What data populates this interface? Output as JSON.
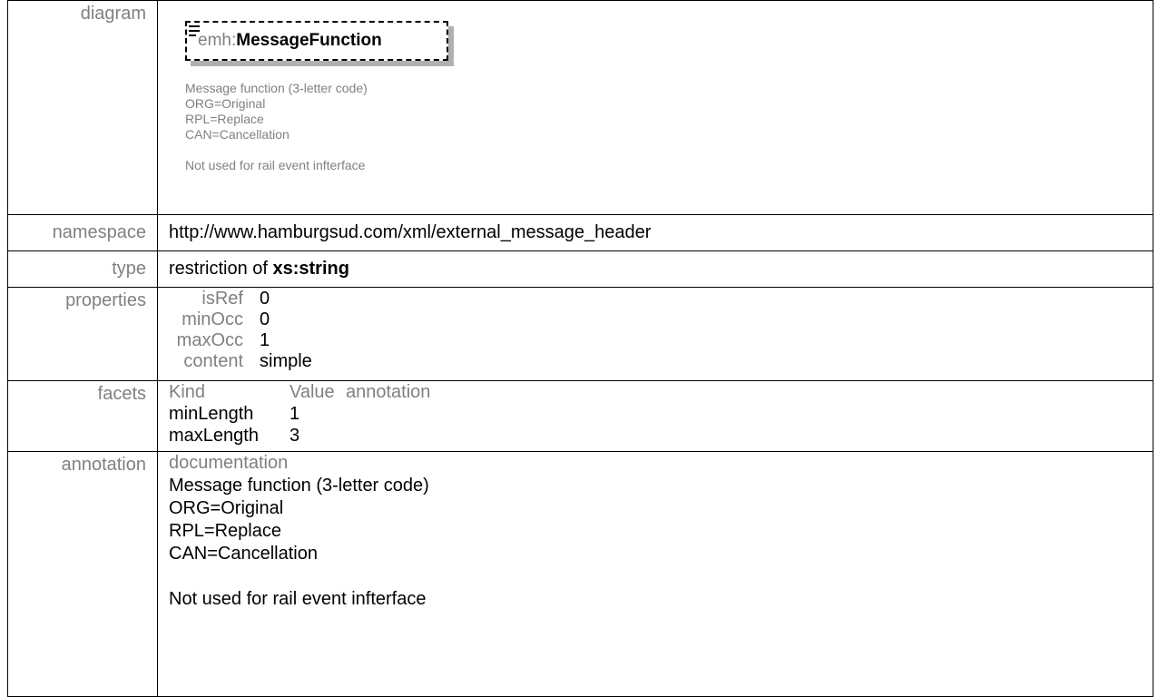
{
  "labels": {
    "diagram": "diagram",
    "namespace": "namespace",
    "type": "type",
    "properties": "properties",
    "facets": "facets",
    "annotation": "annotation"
  },
  "diagram": {
    "element_prefix": "emh:",
    "element_name": "MessageFunction",
    "note_lines": [
      "Message function (3-letter code)",
      "ORG=Original",
      "RPL=Replace",
      "CAN=Cancellation",
      "",
      "Not used for rail event infterface"
    ]
  },
  "namespace": "http://www.hamburgsud.com/xml/external_message_header",
  "type": {
    "prefix": "restriction of ",
    "base": "xs:string"
  },
  "properties": [
    {
      "key": "isRef",
      "value": "0"
    },
    {
      "key": "minOcc",
      "value": "0"
    },
    {
      "key": "maxOcc",
      "value": "1"
    },
    {
      "key": "content",
      "value": "simple"
    }
  ],
  "facets": {
    "headers": [
      "Kind",
      "Value",
      "annotation"
    ],
    "rows": [
      {
        "kind": "minLength",
        "value": "1",
        "annotation": ""
      },
      {
        "kind": "maxLength",
        "value": "3",
        "annotation": ""
      }
    ]
  },
  "annotation": {
    "heading": "documentation",
    "lines": [
      "Message function (3-letter code)",
      "ORG=Original",
      "RPL=Replace",
      "CAN=Cancellation",
      "",
      "Not used for rail event infterface"
    ]
  }
}
